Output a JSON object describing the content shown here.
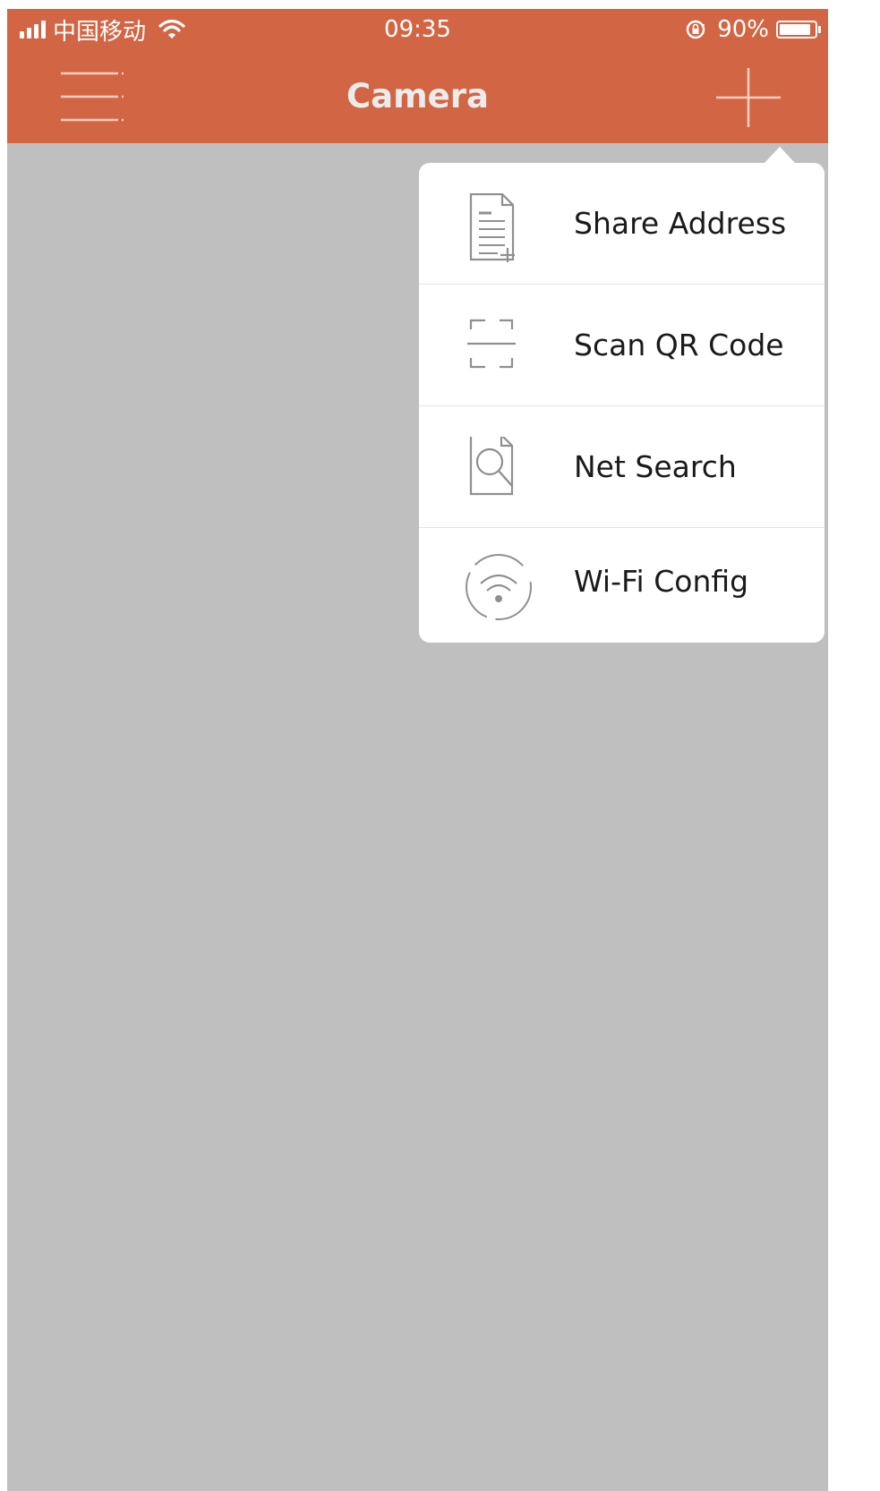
{
  "statusbar": {
    "carrier": "中国移动",
    "time": "09:35",
    "battery_percent": "90%",
    "battery_level": 0.9,
    "icons": [
      "signal-icon",
      "wifi-icon",
      "rotation-lock-icon",
      "battery-icon"
    ]
  },
  "navbar": {
    "title": "Camera",
    "left_icon": "menu-icon",
    "right_icon": "plus-icon"
  },
  "popover_menu": {
    "items": [
      {
        "label": "Share Address",
        "icon": "share-address-icon"
      },
      {
        "label": "Scan QR Code",
        "icon": "qr-scan-icon"
      },
      {
        "label": "Net Search",
        "icon": "net-search-icon"
      },
      {
        "label": "Wi-Fi Config",
        "icon": "wifi-config-icon"
      }
    ]
  },
  "colors": {
    "header": "#d26544",
    "background": "#bfbfbf",
    "popover": "#ffffff",
    "icon_gray": "#8f8f8f",
    "text": "#1a1a1a"
  }
}
